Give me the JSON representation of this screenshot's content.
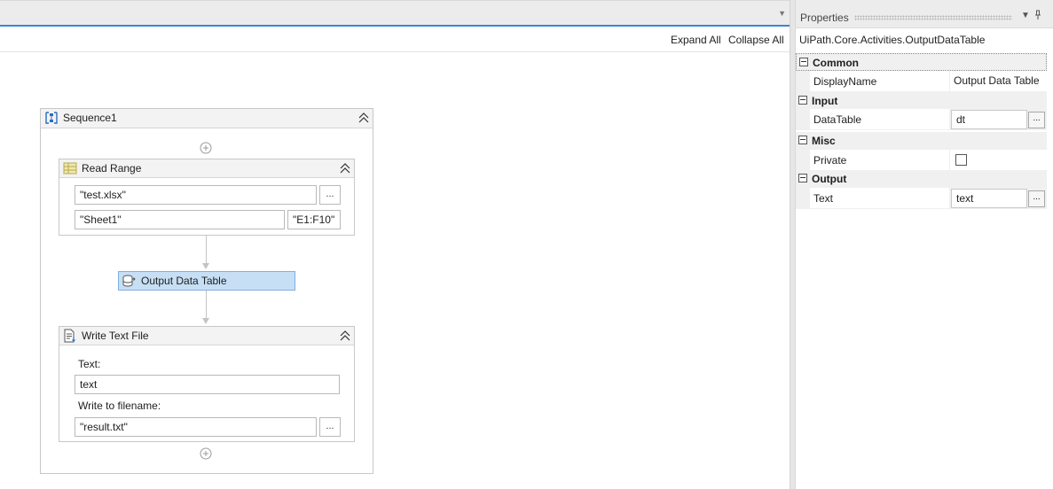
{
  "designer": {
    "expand_all": "Expand All",
    "collapse_all": "Collapse All"
  },
  "sequence": {
    "title": "Sequence1"
  },
  "read_range": {
    "title": "Read Range",
    "workbook_path": "\"test.xlsx\"",
    "sheet_name": "\"Sheet1\"",
    "range": "\"E1:F10\"",
    "browse_label": "..."
  },
  "output_data_table": {
    "title": "Output Data Table"
  },
  "write_text_file": {
    "title": "Write Text File",
    "text_label": "Text:",
    "text_value": "text",
    "filename_label": "Write to filename:",
    "filename_value": "\"result.txt\"",
    "browse_label": "..."
  },
  "properties": {
    "title": "Properties",
    "type_name": "UiPath.Core.Activities.OutputDataTable",
    "categories": [
      {
        "label": "Common",
        "rows": [
          {
            "name": "DisplayName",
            "value": "Output Data Table"
          }
        ]
      },
      {
        "label": "Input",
        "rows": [
          {
            "name": "DataTable",
            "value": "dt"
          }
        ]
      },
      {
        "label": "Misc",
        "rows": [
          {
            "name": "Private",
            "value": ""
          }
        ]
      },
      {
        "label": "Output",
        "rows": [
          {
            "name": "Text",
            "value": "text"
          }
        ]
      }
    ],
    "browse_label": "..."
  },
  "colors": {
    "accent": "#3a86d4",
    "selected_activity_bg": "#c7dff5",
    "selected_activity_border": "#7fb0e0"
  },
  "icons": [
    "sequence-icon",
    "read-range-icon",
    "output-data-table-icon",
    "write-text-file-icon",
    "collapse-icon",
    "add-activity-icon",
    "pin-icon",
    "dropdown-icon"
  ]
}
